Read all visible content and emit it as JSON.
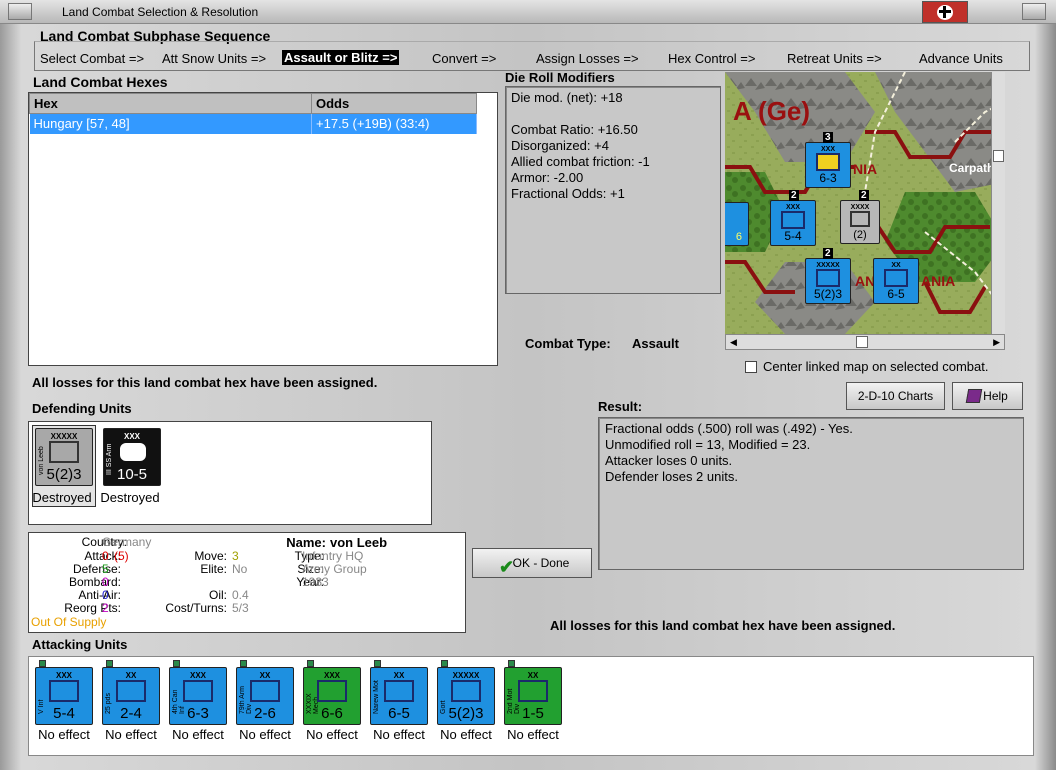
{
  "window": {
    "title": "Land Combat Selection & Resolution"
  },
  "subphase": {
    "heading": "Land Combat Subphase Sequence",
    "steps": [
      "Select Combat =>",
      "Att Snow Units =>",
      "Assault or Blitz =>",
      "Convert =>",
      "Assign Losses =>",
      "Hex Control =>",
      "Retreat Units =>",
      "Advance Units"
    ],
    "active_index": 2
  },
  "hexes": {
    "heading": "Land Combat Hexes",
    "columns": [
      "Hex",
      "Odds"
    ],
    "rows": [
      {
        "hex": "Hungary [57, 48]",
        "odds": "+17.5 (+19B) (33:4)"
      }
    ]
  },
  "modifiers": {
    "heading": "Die Roll Modifiers",
    "net": "Die mod. (net): +18",
    "lines": [
      "Combat Ratio: +16.50",
      "Disorganized: +4",
      "Allied combat friction: -1",
      "Armor: -2.00",
      "Fractional Odds: +1"
    ]
  },
  "map": {
    "labels": [
      "A (Ge)",
      "NIA",
      "Carpathi",
      "AN",
      "ANIA"
    ],
    "checkbox_label": "Center linked map on selected combat.",
    "counters": [
      {
        "size": "XXX",
        "value": "6-3",
        "side": "4th Can Inf"
      },
      {
        "size": "XXX",
        "value": "5-4",
        "side": "V Inf"
      },
      {
        "size": "XXXX",
        "value": "(2)",
        "side": ""
      },
      {
        "size": "XXXXX",
        "value": "5(2)3",
        "side": "Gort"
      },
      {
        "size": "XX",
        "value": "6-5",
        "side": "Narew Mot"
      },
      {
        "size": "",
        "value": "6",
        "side": "ing"
      }
    ],
    "stack_numbers": [
      "3",
      "2",
      "2",
      "2"
    ]
  },
  "combat_type": {
    "label": "Combat Type:",
    "value": "Assault"
  },
  "losses_note": "All losses for this land combat hex have been assigned.",
  "defending": {
    "heading": "Defending Units",
    "units": [
      {
        "size": "XXXXX",
        "side": "von Leeb",
        "value": "5(2)3",
        "status": "Destroyed"
      },
      {
        "size": "XXX",
        "side": "III SS Arm",
        "value": "10-5",
        "status": "Destroyed"
      }
    ]
  },
  "unit_info": {
    "country_label": "Country:",
    "country": "Germany",
    "attack_label": "Attack:",
    "attack": "0",
    "attack_extra": "(5)",
    "defense_label": "Defense:",
    "defense": "5",
    "bombard_label": "Bombard:",
    "bombard": "0",
    "antiair_label": "Anti-Air:",
    "antiair": "0",
    "reorg_label": "Reorg Pts:",
    "reorg": "2",
    "supply": "Out Of Supply",
    "move_label": "Move:",
    "move": "3",
    "elite_label": "Elite:",
    "elite": "No",
    "oil_label": "Oil:",
    "oil": "0.4",
    "cost_label": "Cost/Turns:",
    "cost": "5/3",
    "name_label": "Name:",
    "name": "von Leeb",
    "type_label": "Type:",
    "type": "Infantry HQ",
    "size_label": "Size:",
    "size": "Army Group",
    "year_label": "Year:",
    "year": "1933"
  },
  "buttons": {
    "charts": "2-D-10 Charts",
    "help": "Help",
    "ok": "OK - Done"
  },
  "result": {
    "heading": "Result:",
    "lines": [
      "Fractional odds (.500) roll was (.492)  - Yes.",
      "Unmodified roll = 13, Modified = 23.",
      "Attacker loses 0 units.",
      "Defender loses 2 units."
    ]
  },
  "attacking": {
    "heading": "Attacking Units",
    "units": [
      {
        "size": "XXX",
        "side": "V Inf",
        "value": "5-4",
        "status": "No effect",
        "color": "#1e90e0"
      },
      {
        "size": "XX",
        "side": "25 pds",
        "value": "2-4",
        "status": "No effect",
        "color": "#1e90e0"
      },
      {
        "size": "XXX",
        "side": "4th Can Inf",
        "value": "6-3",
        "status": "No effect",
        "color": "#1e90e0"
      },
      {
        "size": "XX",
        "side": "79th Arm Div",
        "value": "2-6",
        "status": "No effect",
        "color": "#1e90e0"
      },
      {
        "size": "XXX",
        "side": "XXXIX Mech",
        "value": "6-6",
        "status": "No effect",
        "color": "#22a030"
      },
      {
        "size": "XX",
        "side": "Narew Mot",
        "value": "6-5",
        "status": "No effect",
        "color": "#1e90e0"
      },
      {
        "size": "XXXXX",
        "side": "Gort",
        "value": "5(2)3",
        "status": "No effect",
        "color": "#1e90e0"
      },
      {
        "size": "XX",
        "side": "2nd Mot Div",
        "value": "1-5",
        "status": "No effect",
        "color": "#22a030"
      }
    ]
  },
  "colors": {
    "selection": "#3399ff",
    "allied_blue": "#1e90e0",
    "soviet_green": "#22a030",
    "destroyed_gray": "#a8a8a8"
  }
}
